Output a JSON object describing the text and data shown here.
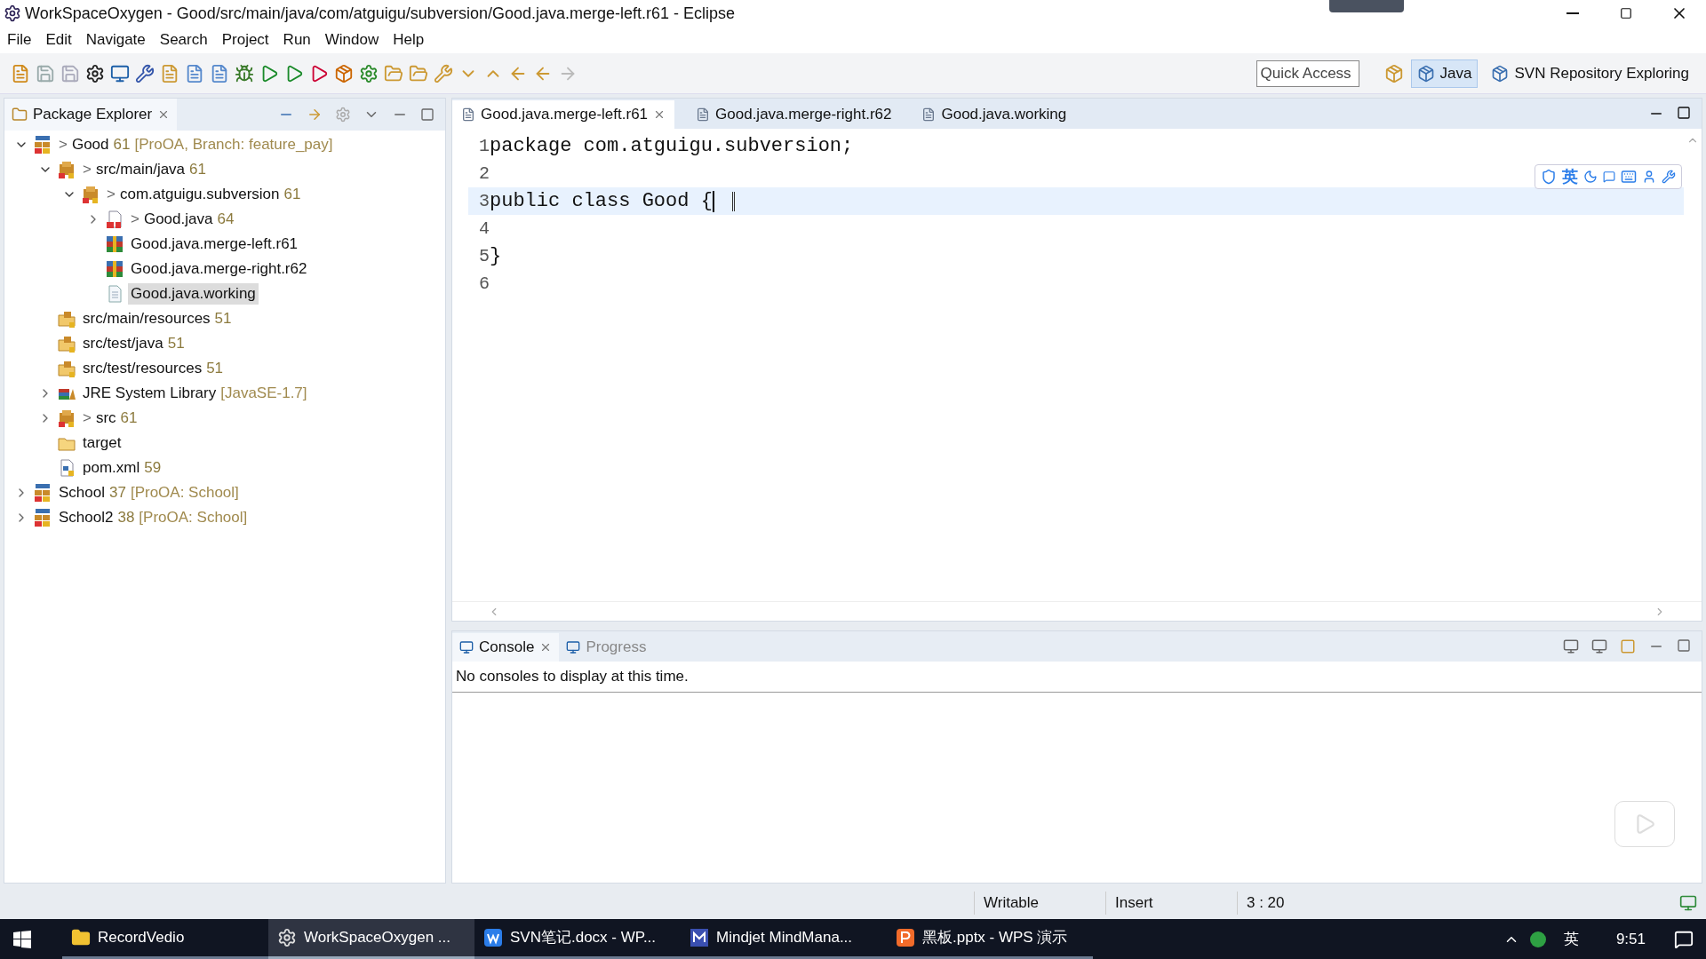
{
  "window": {
    "title": "WorkSpaceOxygen - Good/src/main/java/com/atguigu/subversion/Good.java.merge-left.r61 - Eclipse"
  },
  "menu": [
    "File",
    "Edit",
    "Navigate",
    "Search",
    "Project",
    "Run",
    "Window",
    "Help"
  ],
  "quick_access": {
    "placeholder": "Quick Access"
  },
  "perspectives": [
    {
      "label": "Java",
      "selected": true
    },
    {
      "label": "SVN Repository Exploring",
      "selected": false
    }
  ],
  "package_explorer": {
    "title": "Package Explorer",
    "tree": [
      {
        "kind": "project",
        "marker": ">",
        "name": "Good",
        "count": "61",
        "extra": "[ProOA, Branch: feature_pay]",
        "expanded": true,
        "selected": false,
        "children": [
          {
            "kind": "source-folder",
            "marker": ">",
            "name": "src/main/java",
            "count": "61",
            "expanded": true,
            "selected": false,
            "children": [
              {
                "kind": "package",
                "marker": ">",
                "name": "com.atguigu.subversion",
                "count": "61",
                "expanded": true,
                "selected": false,
                "children": [
                  {
                    "kind": "java-file",
                    "marker": ">",
                    "name": "Good.java",
                    "count": "64",
                    "expanded": false,
                    "selected": false
                  },
                  {
                    "kind": "archive-file",
                    "name": "Good.java.merge-left.r61",
                    "selected": false
                  },
                  {
                    "kind": "archive-file",
                    "name": "Good.java.merge-right.r62",
                    "selected": false
                  },
                  {
                    "kind": "text-file",
                    "name": "Good.java.working",
                    "selected": true
                  }
                ]
              }
            ]
          },
          {
            "kind": "resource-folder",
            "name": "src/main/resources",
            "count": "51",
            "selected": false
          },
          {
            "kind": "resource-folder",
            "name": "src/test/java",
            "count": "51",
            "selected": false
          },
          {
            "kind": "resource-folder",
            "name": "src/test/resources",
            "count": "51",
            "selected": false
          },
          {
            "kind": "library",
            "name": "JRE System Library",
            "extra": "[JavaSE-1.7]",
            "expanded": false,
            "selected": false
          },
          {
            "kind": "source-folder",
            "marker": ">",
            "name": "src",
            "count": "61",
            "expanded": false,
            "selected": false
          },
          {
            "kind": "folder",
            "name": "target",
            "selected": false
          },
          {
            "kind": "xml-file",
            "name": "pom.xml",
            "count": "59",
            "selected": false
          }
        ]
      },
      {
        "kind": "project",
        "name": "School",
        "count": "37",
        "extra": "[ProOA: School]",
        "expanded": false,
        "selected": false
      },
      {
        "kind": "project",
        "name": "School2",
        "count": "38",
        "extra": "[ProOA: School]",
        "expanded": false,
        "selected": false
      }
    ]
  },
  "editor": {
    "tabs": [
      {
        "label": "Good.java.merge-left.r61",
        "selected": true
      },
      {
        "label": "Good.java.merge-right.r62",
        "selected": false
      },
      {
        "label": "Good.java.working",
        "selected": false
      }
    ],
    "lines": [
      {
        "number": "1",
        "text": "package com.atguigu.subversion;",
        "current": false
      },
      {
        "number": "2",
        "current": false
      },
      {
        "number": "3",
        "text": "public class Good {",
        "current": true
      },
      {
        "number": "4",
        "current": false
      },
      {
        "number": "5",
        "text": "}",
        "current": false
      },
      {
        "number": "6",
        "current": false
      }
    ]
  },
  "ime_toolbar": {
    "label": "英"
  },
  "console": {
    "tabs": [
      {
        "label": "Console",
        "selected": true
      },
      {
        "label": "Progress",
        "selected": false
      }
    ],
    "message": "No consoles to display at this time."
  },
  "status_bar": [
    "Writable",
    "Insert",
    "3 : 20"
  ],
  "taskbar": {
    "items": [
      {
        "label": "RecordVedio",
        "kind": "folder",
        "active": false
      },
      {
        "label": "WorkSpaceOxygen ...",
        "kind": "eclipse",
        "active": true
      },
      {
        "label": "SVN笔记.docx - WP...",
        "kind": "writer",
        "active": false
      },
      {
        "label": "Mindjet MindMana...",
        "kind": "mindmap",
        "active": false
      },
      {
        "label": "黑板.pptx - WPS 演示",
        "kind": "slides",
        "active": false
      }
    ],
    "ime": "英",
    "time": "9:51"
  }
}
